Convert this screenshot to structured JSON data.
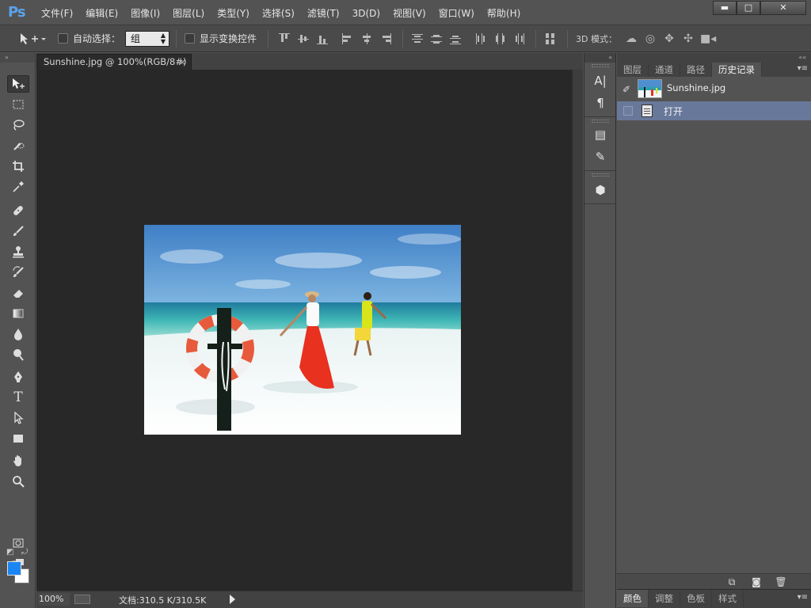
{
  "app": {
    "logo": "Ps"
  },
  "menu": [
    "文件(F)",
    "编辑(E)",
    "图像(I)",
    "图层(L)",
    "类型(Y)",
    "选择(S)",
    "滤镜(T)",
    "3D(D)",
    "视图(V)",
    "窗口(W)",
    "帮助(H)"
  ],
  "window_buttons": {
    "minimize": "▬",
    "maximize": "□",
    "close": "✕"
  },
  "options": {
    "auto_select_label": "自动选择：",
    "auto_select_value": "组",
    "show_transform_label": "显示变换控件",
    "mode_3d_label": "3D 模式："
  },
  "document": {
    "tab_title": "Sunshine.jpg @ 100%(RGB/8#)",
    "tab_close": "×",
    "zoom": "100%",
    "doc_info": "文档:310.5 K/310.5K"
  },
  "colors": {
    "foreground": "#1a86f4",
    "background": "#ffffff",
    "history_highlight": "#68789a"
  },
  "panels": {
    "tabs": [
      {
        "label": "图层",
        "active": false
      },
      {
        "label": "通道",
        "active": false
      },
      {
        "label": "路径",
        "active": false
      },
      {
        "label": "历史记录",
        "active": true
      }
    ],
    "history": {
      "snapshot": "Sunshine.jpg",
      "steps": [
        {
          "label": "打开",
          "selected": true
        }
      ]
    },
    "bottom_tabs": [
      {
        "label": "颜色",
        "active": true
      },
      {
        "label": "调整",
        "active": false
      },
      {
        "label": "色板",
        "active": false
      },
      {
        "label": "样式",
        "active": false
      }
    ]
  },
  "icons": {
    "tools": [
      "move-tool-icon",
      "marquee-tool-icon",
      "lasso-tool-icon",
      "quick-select-tool-icon",
      "crop-tool-icon",
      "eyedropper-tool-icon",
      "healing-brush-tool-icon",
      "brush-tool-icon",
      "clone-stamp-tool-icon",
      "history-brush-tool-icon",
      "eraser-tool-icon",
      "gradient-tool-icon",
      "blur-tool-icon",
      "dodge-tool-icon",
      "pen-tool-icon",
      "type-tool-icon",
      "path-select-tool-icon",
      "rectangle-tool-icon",
      "hand-tool-icon",
      "zoom-tool-icon"
    ]
  }
}
